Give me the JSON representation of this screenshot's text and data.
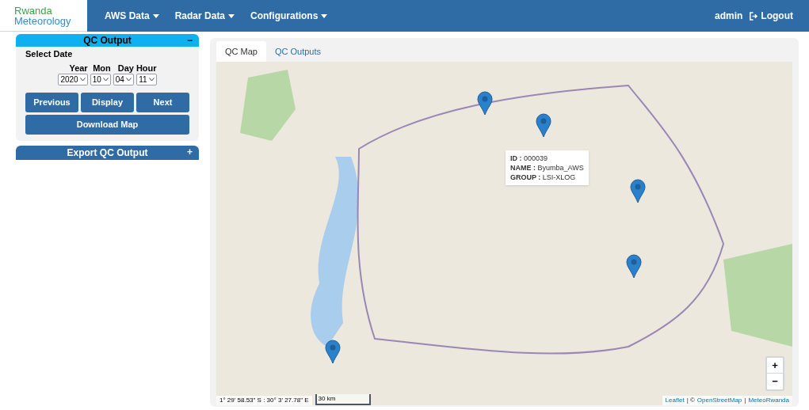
{
  "logo": {
    "line_1": "Rwanda",
    "line_2": "Meteorology"
  },
  "nav": {
    "menus": [
      {
        "label": "AWS Data"
      },
      {
        "label": "Radar Data"
      },
      {
        "label": "Configurations"
      }
    ],
    "user": "admin",
    "logout": "Logout"
  },
  "qc_panel": {
    "title": "QC Output",
    "toggle": "−",
    "expanded": true,
    "section_label": "Select Date",
    "selects": [
      {
        "label": "Year",
        "value": "2020"
      },
      {
        "label": "Mon",
        "value": "10"
      },
      {
        "label": "Day",
        "value": "04"
      },
      {
        "label": "Hour",
        "value": "11"
      }
    ],
    "buttons": [
      "Previous",
      "Display",
      "Next"
    ],
    "download": "Download Map"
  },
  "export_panel": {
    "title": "Export QC Output",
    "toggle": "+",
    "expanded": false
  },
  "tabs": [
    {
      "label": "QC Map",
      "selected": true
    },
    {
      "label": "QC Outputs",
      "selected": false
    }
  ],
  "map": {
    "popup": {
      "lines": [
        "**ID :** 000039",
        "**NAME :** Byumba_AWS",
        "**GROUP :** LSI-XLOG"
      ]
    },
    "zoom_in": "+",
    "zoom_out": "−",
    "coordinates": "1° 29' 58.53\" S : 30° 3' 27.78\" E",
    "scale": "30 km",
    "attribution": [
      {
        "text": "Leaflet",
        "kind": "link"
      },
      {
        "text": "| ©",
        "kind": "text"
      },
      {
        "text": "OpenStreetMap",
        "kind": "link"
      },
      {
        "text": "|",
        "kind": "text"
      },
      {
        "text": "MeteoRwanda",
        "kind": "link"
      }
    ]
  }
}
